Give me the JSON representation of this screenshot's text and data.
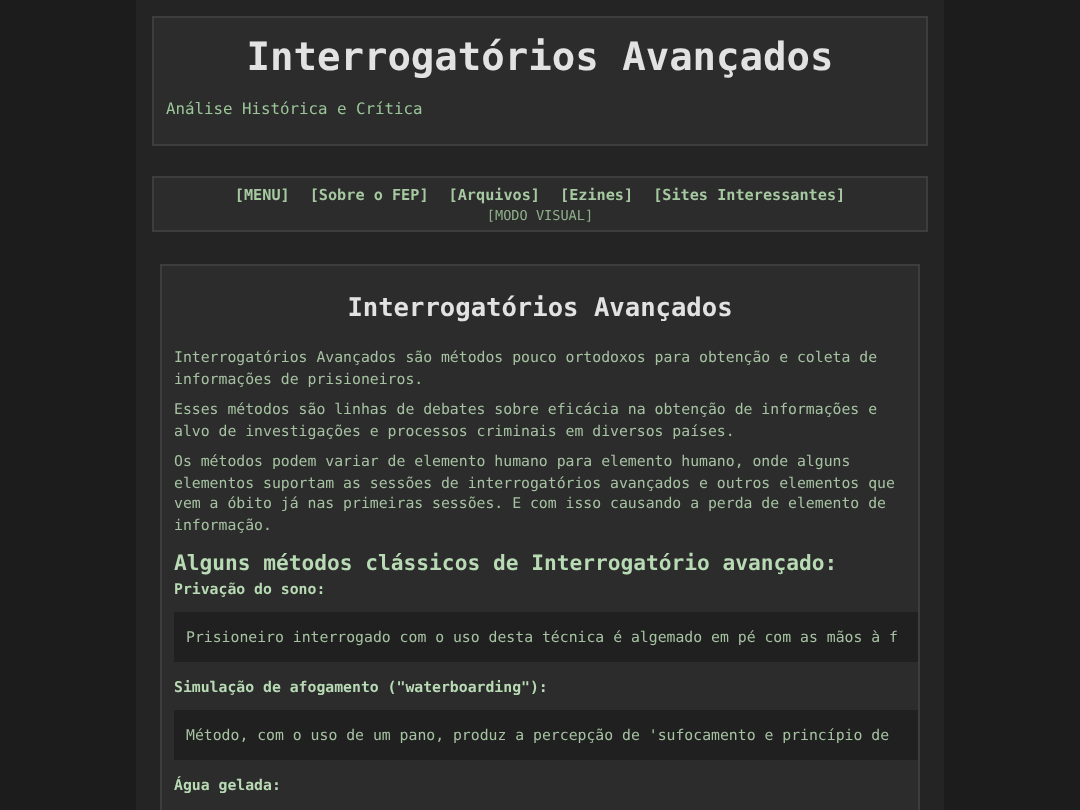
{
  "header": {
    "title": "Interrogatórios Avançados",
    "subtitle": "Análise Histórica e Crítica"
  },
  "nav": {
    "links": [
      "[MENU]",
      "[Sobre o FEP]",
      "[Arquivos]",
      "[Ezines]",
      "[Sites Interessantes]"
    ],
    "visual_mode": "[MODO VISUAL]"
  },
  "article": {
    "title": "Interrogatórios Avançados",
    "paragraphs": [
      "Interrogatórios Avançados são métodos pouco ortodoxos para obtenção e coleta de informações de prisioneiros.",
      "Esses métodos são linhas de debates sobre eficácia na obtenção de informações e alvo de investigações e processos criminais em diversos países.",
      "Os métodos podem variar de elemento humano para elemento humano, onde alguns elementos suportam as sessões de interrogatórios avançados e outros elementos que vem a óbito já nas primeiras sessões. E com isso causando a perda de elemento de informação."
    ],
    "section_heading": "Alguns métodos clássicos de Interrogatório avançado:",
    "methods": [
      {
        "name": "Privação do sono:",
        "description": "Prisioneiro interrogado com o uso desta técnica é algemado em pé com as mãos à f"
      },
      {
        "name": "Simulação de afogamento (\"waterboarding\"):",
        "description": "Método, com o uso de um pano, produz a percepção de 'sufocamento e princípio de"
      },
      {
        "name": "Água gelada:"
      }
    ]
  }
}
